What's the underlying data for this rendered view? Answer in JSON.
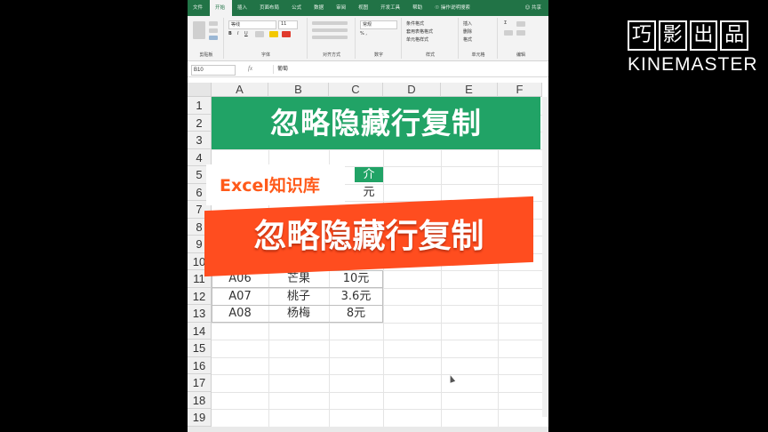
{
  "ribbon": {
    "tabs": [
      "文件",
      "开始",
      "插入",
      "页面布局",
      "公式",
      "数据",
      "审阅",
      "视图",
      "开发工具",
      "帮助",
      "操作说明搜索",
      "共享"
    ],
    "active_tab": "开始",
    "font_name": "等线",
    "font_size": "11",
    "number_format": "常规",
    "styles": [
      "条件格式",
      "套用表格格式",
      "单元格样式"
    ],
    "cells": [
      "插入",
      "删除",
      "格式"
    ],
    "groups": [
      "剪贴板",
      "字体",
      "对齐方式",
      "数字",
      "样式",
      "单元格",
      "编辑"
    ]
  },
  "formula_bar": {
    "name_box": "B10",
    "fx": "fx",
    "content": "葡萄"
  },
  "grid": {
    "columns": [
      "A",
      "B",
      "C",
      "D",
      "E",
      "F"
    ],
    "rows": [
      "1",
      "2",
      "3",
      "4",
      "5",
      "6",
      "7",
      "8",
      "9",
      "10",
      "11",
      "12",
      "13",
      "14",
      "15",
      "16",
      "17",
      "18",
      "19"
    ],
    "banner_title": "忽略隐藏行复制",
    "header_visible_part": "介",
    "partial_cell_c6": "元",
    "data_rows": [
      {
        "code": "A06",
        "fruit": "芒果",
        "price": "10元"
      },
      {
        "code": "A07",
        "fruit": "桃子",
        "price": "3.6元"
      },
      {
        "code": "A08",
        "fruit": "杨梅",
        "price": "8元"
      }
    ]
  },
  "overlay": {
    "channel": "Excel知识库",
    "title": "忽略隐藏行复制"
  },
  "watermark": {
    "chars": [
      "巧",
      "影",
      "出",
      "品"
    ],
    "brand": "KINEMASTER"
  },
  "colors": {
    "excel_green": "#217346",
    "banner_green": "#21a366",
    "overlay_orange": "#ff4d1f"
  }
}
